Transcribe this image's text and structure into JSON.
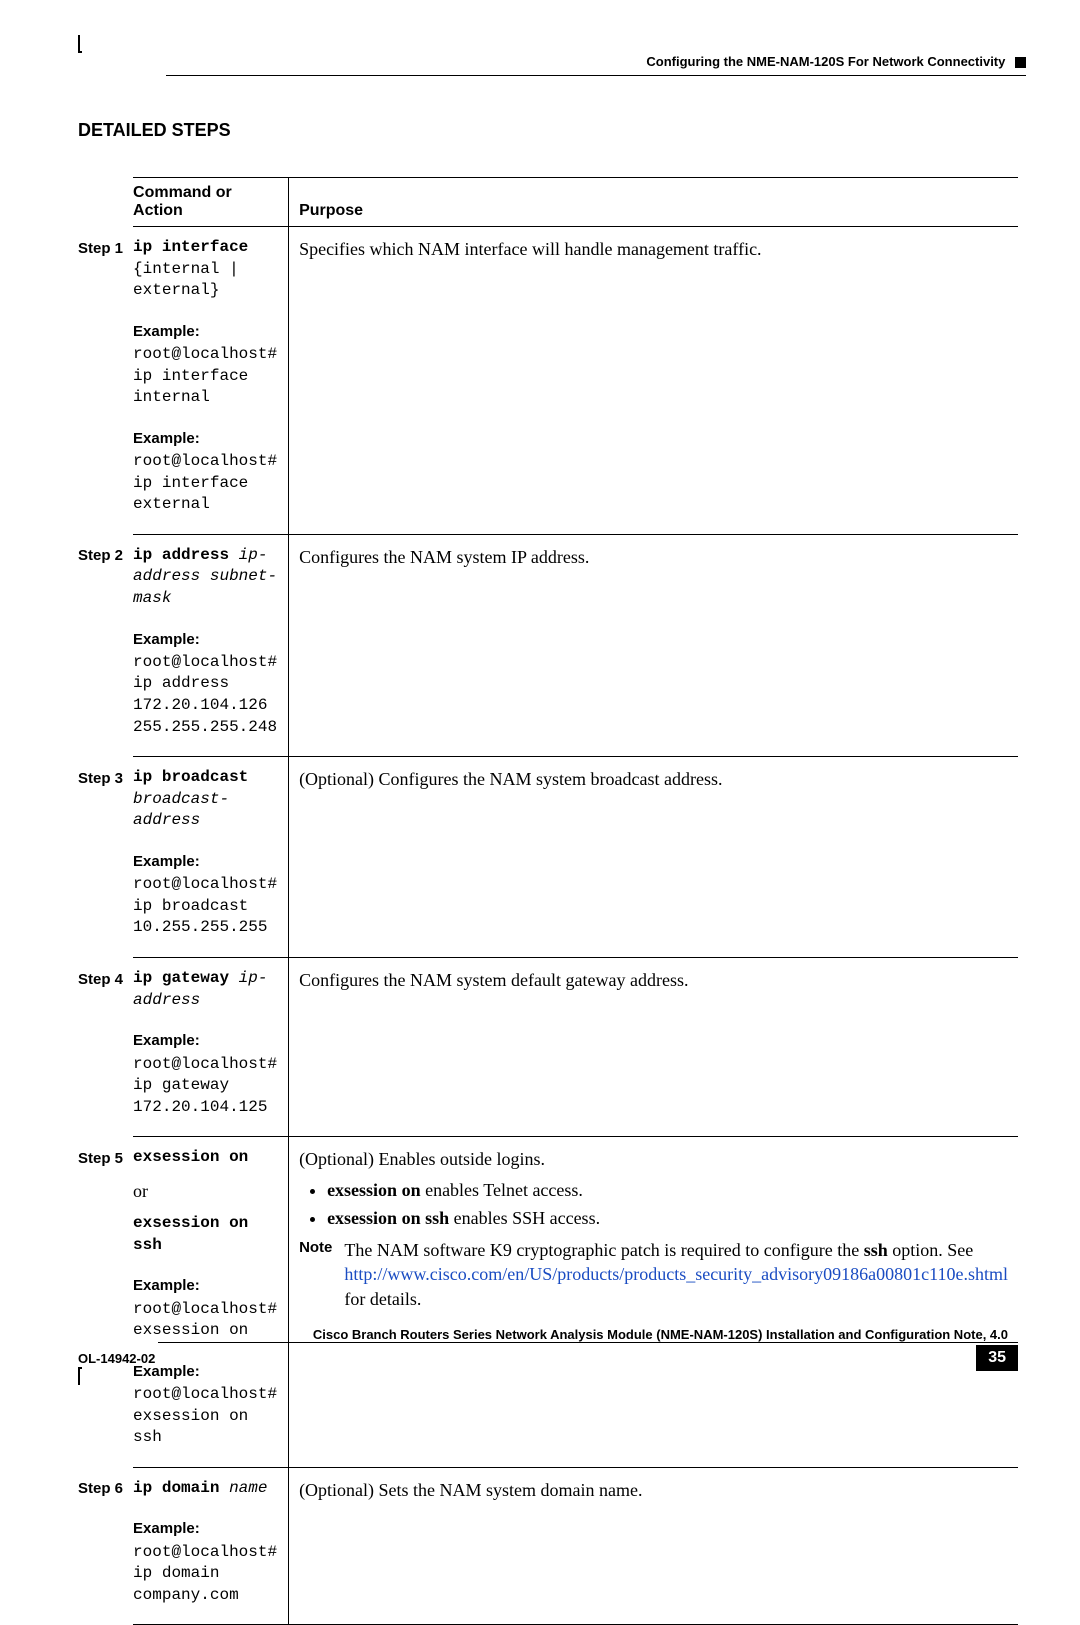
{
  "header": {
    "text": "Configuring the NME-NAM-120S For Network Connectivity"
  },
  "section_title": "DETAILED STEPS",
  "table": {
    "headers": {
      "step": "",
      "command": "Command or Action",
      "purpose": "Purpose"
    },
    "rows": [
      {
        "step": "Step 1",
        "cmd_bold": "ip interface",
        "cmd_rest": " {internal | external}",
        "examples": [
          "root@localhost# ip interface internal",
          "root@localhost# ip interface external"
        ],
        "purpose": "Specifies which NAM interface will handle management traffic."
      },
      {
        "step": "Step 2",
        "cmd_bold": "ip address",
        "cmd_italic": " ip-address subnet-mask",
        "examples": [
          "root@localhost# ip address 172.20.104.126 255.255.255.248"
        ],
        "purpose": "Configures the NAM system IP address."
      },
      {
        "step": "Step 3",
        "cmd_bold": "ip broadcast",
        "cmd_italic": " broadcast-address",
        "examples": [
          "root@localhost# ip broadcast 10.255.255.255"
        ],
        "purpose": "(Optional) Configures the NAM system broadcast address."
      },
      {
        "step": "Step 4",
        "cmd_bold": "ip gateway",
        "cmd_italic": " ip-address",
        "examples": [
          "root@localhost# ip gateway 172.20.104.125"
        ],
        "purpose": "Configures the NAM system default gateway address."
      },
      {
        "step": "Step 5",
        "cmd_bold": "exsession on",
        "or": "or",
        "cmd_bold2": "exsession on ssh",
        "examples": [
          "root@localhost# exsession on",
          "root@localhost# exsession on ssh"
        ],
        "purpose_lead": "(Optional) Enables outside logins.",
        "bullet1_bold": "exsession on",
        "bullet1_rest": " enables Telnet access.",
        "bullet2_bold": "exsession on ssh",
        "bullet2_rest": " enables SSH access.",
        "note_label": "Note",
        "note_pre": "The NAM software K9 cryptographic patch is required to configure the ",
        "note_bold": "ssh",
        "note_mid": " option. See ",
        "note_link": "http://www.cisco.com/en/US/products/products_security_advisory09186a00801c110e.shtml",
        "note_post": " for details."
      },
      {
        "step": "Step 6",
        "cmd_bold": "ip domain",
        "cmd_italic": " name",
        "examples": [
          "root@localhost# ip domain company.com"
        ],
        "purpose": "(Optional) Sets the NAM system domain name."
      }
    ],
    "example_label": "Example:"
  },
  "footer": {
    "doc_title": "Cisco Branch Routers Series Network Analysis Module (NME-NAM-120S) Installation and Configuration Note, 4.0",
    "doc_id": "OL-14942-02",
    "page": "35"
  }
}
